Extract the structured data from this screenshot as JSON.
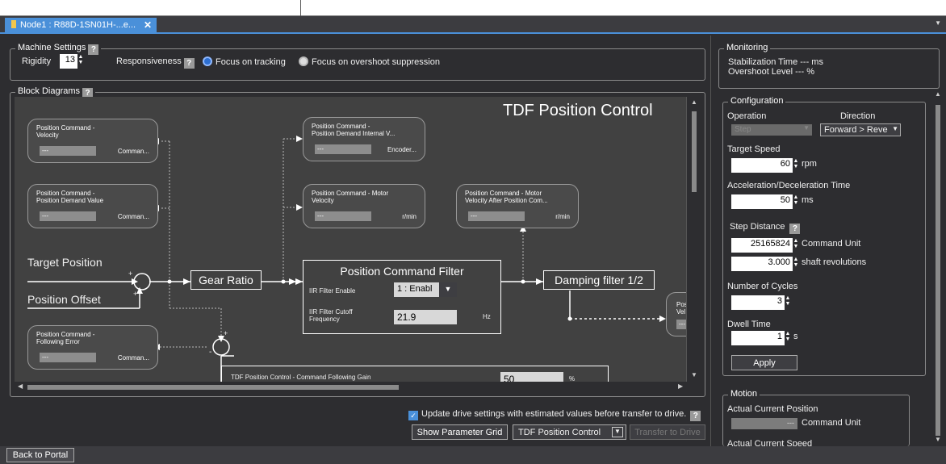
{
  "tab": {
    "title": "Node1 : R88D-1SN01H-...e..."
  },
  "machine_settings": {
    "group_label": "Machine Settings",
    "rigidity_label": "Rigidity",
    "rigidity_value": "13",
    "responsiveness_label": "Responsiveness",
    "option_tracking": "Focus on tracking",
    "option_overshoot": "Focus on overshoot suppression"
  },
  "block_diagrams": {
    "group_label": "Block Diagrams",
    "title": "TDF Position Control",
    "monitors": [
      {
        "title": "Position Command -\nVelocity",
        "value": "---",
        "unit": "Comman..."
      },
      {
        "title": "Position Command -\nPosition Demand Value",
        "value": "---",
        "unit": "Comman..."
      },
      {
        "title": "Position Command -\nFollowing Error",
        "value": "---",
        "unit": "Comman..."
      },
      {
        "title": "Position Command -\nPosition Demand Internal V...",
        "value": "---",
        "unit": "Encoder..."
      },
      {
        "title": "Position Command - Motor\nVelocity",
        "value": "---",
        "unit": "r/min"
      },
      {
        "title": "Position Command - Motor\nVelocity After Position Com...",
        "value": "---",
        "unit": "r/min"
      },
      {
        "title": "Pos\nVel",
        "value": "---",
        "unit": ""
      }
    ],
    "target_position": "Target Position",
    "position_offset": "Position Offset",
    "gear_ratio": "Gear Ratio",
    "filter_title": "Position Command Filter",
    "iir_enable_label": "IIR Filter Enable",
    "iir_enable_value": "1 : Enabl",
    "iir_cutoff_label": "IIR Filter Cutoff\nFrequency",
    "iir_cutoff_value": "21.9",
    "iir_cutoff_unit": "Hz",
    "damping_filter": "Damping filter 1/2",
    "tdf_gain_label": "TDF Position Control - Command Following Gain",
    "tdf_gain_value": "50",
    "tdf_gain_unit": "%",
    "plus": "+",
    "minus": "-"
  },
  "bottom": {
    "update_checkbox_label": "Update drive settings with estimated values before transfer to drive.",
    "show_grid_button": "Show Parameter Grid",
    "mode_select": "TDF Position Control",
    "transfer_button": "Transfer to Drive",
    "back_button": "Back to Portal"
  },
  "monitoring": {
    "group_label": "Monitoring",
    "stabilization": "Stabilization Time --- ms",
    "overshoot": "Overshoot Level  --- %"
  },
  "configuration": {
    "group_label": "Configuration",
    "operation_label": "Operation",
    "operation_value": "Step",
    "direction_label": "Direction",
    "direction_value": "Forward > Reve",
    "target_speed_label": "Target Speed",
    "target_speed_value": "60",
    "target_speed_unit": "rpm",
    "accel_label": "Acceleration/Deceleration Time",
    "accel_value": "50",
    "accel_unit": "ms",
    "step_label": "Step Distance",
    "step_value": "25165824",
    "step_unit": "Command Unit",
    "rev_value": "3.000",
    "rev_unit": "shaft revolutions",
    "cycles_label": "Number of Cycles",
    "cycles_value": "3",
    "dwell_label": "Dwell Time",
    "dwell_value": "1",
    "dwell_unit": "s",
    "apply_button": "Apply"
  },
  "motion": {
    "group_label": "Motion",
    "actual_position_label": "Actual Current Position",
    "actual_position_value": "---",
    "actual_position_unit": "Command Unit",
    "actual_speed_label": "Actual Current Speed"
  }
}
